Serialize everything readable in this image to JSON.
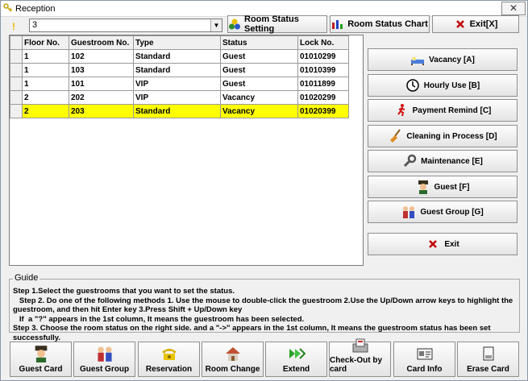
{
  "window": {
    "title": "Reception",
    "close_glyph": "✕"
  },
  "toolbar": {
    "marker_glyph": "!",
    "floor_select": {
      "value": "3",
      "arrow_glyph": "▼"
    },
    "room_status_setting": {
      "label": "Room Status Setting",
      "icon": "circles-icon"
    },
    "room_status_chart": {
      "label": "Room Status Chart",
      "icon": "bar-chart-icon"
    },
    "exit": {
      "label": "Exit[X]",
      "icon": "x-icon"
    }
  },
  "grid": {
    "columns": [
      "Floor No.",
      "Guestroom No.",
      "Type",
      "Status",
      "Lock No."
    ],
    "rows": [
      {
        "floor": "1",
        "room": "102",
        "type": "Standard",
        "status": "Guest",
        "lock": "01010299"
      },
      {
        "floor": "1",
        "room": "103",
        "type": "Standard",
        "status": "Guest",
        "lock": "01010399"
      },
      {
        "floor": "1",
        "room": "101",
        "type": "VIP",
        "status": "Guest",
        "lock": "01011899"
      },
      {
        "floor": "2",
        "room": "202",
        "type": "VIP",
        "status": "Vacancy",
        "lock": "01020299"
      },
      {
        "floor": "2",
        "room": "203",
        "type": "Standard",
        "status": "Vacancy",
        "lock": "01020399"
      }
    ],
    "selected_row": 4,
    "highlight_color": "#ffff00"
  },
  "status_buttons": [
    {
      "label": "Vacancy [A]",
      "icon": "bed-icon"
    },
    {
      "label": "Hourly Use [B]",
      "icon": "clock-icon"
    },
    {
      "label": "Payment Remind [C]",
      "icon": "running-man-icon"
    },
    {
      "label": "Cleaning in Process [D]",
      "icon": "broom-icon"
    },
    {
      "label": "Maintenance [E]",
      "icon": "wrench-icon"
    },
    {
      "label": "Guest [F]",
      "icon": "guest-icon"
    },
    {
      "label": "Guest Group [G]",
      "icon": "guest-group-icon"
    },
    {
      "label": "Exit",
      "icon": "x-icon"
    }
  ],
  "guide": {
    "title": "Guide",
    "lines": [
      "Step 1.Select the guestrooms that you want to set the status.",
      "   Step 2. Do one of the following methods 1. Use the mouse to double-click the guestroom 2.Use the Up/Down arrow keys to highlight the guestroom, and then hit Enter key 3.Press Shift + Up/Down key",
      "   If  a \"?\" appears in the 1st column, It means the guestroom has been selected.",
      "Step 3. Choose the room status on the right side. and a \"->\" appears in the 1st column, It means the guestroom status has been set successfully."
    ]
  },
  "bottom_buttons": [
    {
      "label": "Guest Card",
      "icon": "guest-icon"
    },
    {
      "label": "Guest Group",
      "icon": "guest-group-icon"
    },
    {
      "label": "Reservation",
      "icon": "phone-icon"
    },
    {
      "label": "Room Change",
      "icon": "house-icon"
    },
    {
      "label": "Extend",
      "icon": "arrows-right-icon"
    },
    {
      "label": "Check-Out by card",
      "icon": "card-reader-icon"
    },
    {
      "label": "Card Info",
      "icon": "card-info-icon"
    },
    {
      "label": "Erase Card",
      "icon": "erase-card-icon"
    }
  ]
}
